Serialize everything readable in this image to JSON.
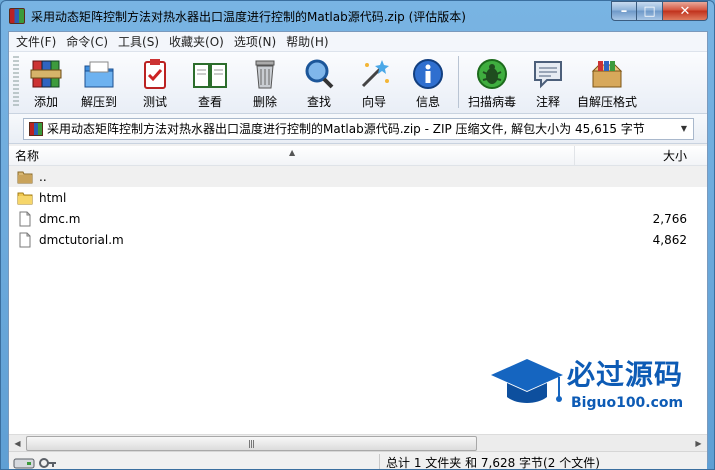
{
  "window": {
    "title": "采用动态矩阵控制方法对热水器出口温度进行控制的Matlab源代码.zip (评估版本)",
    "controls": {
      "minimize": "–",
      "maximize": "□",
      "close": "✕"
    }
  },
  "menu": [
    "文件(F)",
    "命令(C)",
    "工具(S)",
    "收藏夹(O)",
    "选项(N)",
    "帮助(H)"
  ],
  "toolbar": [
    {
      "label": "添加",
      "icon": "add-archive-icon"
    },
    {
      "label": "解压到",
      "icon": "extract-to-icon"
    },
    {
      "label": "测试",
      "icon": "test-icon"
    },
    {
      "label": "查看",
      "icon": "view-book-icon"
    },
    {
      "label": "删除",
      "icon": "delete-trash-icon"
    },
    {
      "label": "查找",
      "icon": "find-magnifier-icon"
    },
    {
      "label": "向导",
      "icon": "wizard-wand-icon"
    },
    {
      "label": "信息",
      "icon": "info-icon"
    },
    {
      "label": "扫描病毒",
      "icon": "virus-scan-bug-icon"
    },
    {
      "label": "注释",
      "icon": "comment-icon"
    },
    {
      "label": "自解压格式",
      "icon": "sfx-box-icon"
    }
  ],
  "address": {
    "text": "采用动态矩阵控制方法对热水器出口温度进行控制的Matlab源代码.zip - ZIP 压缩文件, 解包大小为 45,615 字节"
  },
  "list": {
    "columns": {
      "name": "名称",
      "size": "大小"
    },
    "rows": [
      {
        "name": "..",
        "size": "",
        "icon": "parent-folder-icon"
      },
      {
        "name": "html",
        "size": "",
        "icon": "folder-icon"
      },
      {
        "name": "dmc.m",
        "size": "2,766",
        "icon": "file-icon"
      },
      {
        "name": "dmctutorial.m",
        "size": "4,862",
        "icon": "file-icon"
      }
    ]
  },
  "watermark": {
    "title": "必过源码",
    "subtitle": "Biguo100.com"
  },
  "status": {
    "text": "总计 1 文件夹 和 7,628 字节(2 个文件)"
  },
  "colors": {
    "accent": "#0d5bb5",
    "titlebar": "#79b4e3"
  }
}
